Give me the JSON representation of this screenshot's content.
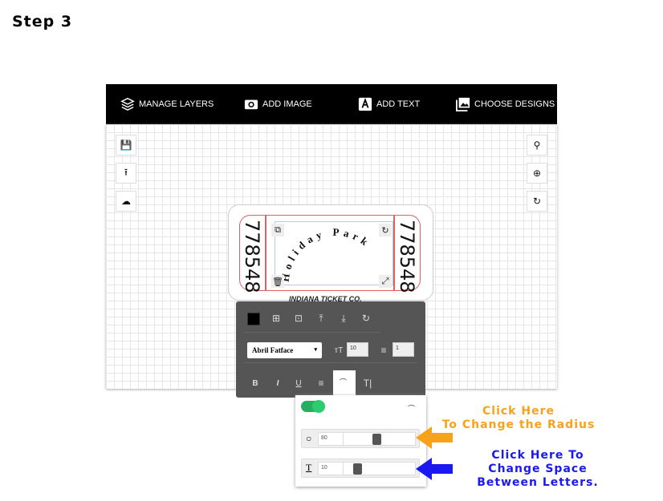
{
  "step_title": "Step 3",
  "toolbar": {
    "manage_layers": "MANAGE LAYERS",
    "add_image": "ADD IMAGE",
    "add_text": "ADD TEXT",
    "choose_designs": "CHOOSE DESIGNS"
  },
  "ticket": {
    "number_left": "778548",
    "number_right": "778548",
    "curved_text": "Holiday Park",
    "company": "INDIANA TICKET CO."
  },
  "editor": {
    "font": "Abril Fatface",
    "font_size": "10",
    "line_height": "1",
    "color": "#000000"
  },
  "curve_panel": {
    "toggle_on": true,
    "radius": "80",
    "radius_fraction": 0.45,
    "spacing": "10",
    "spacing_fraction": 0.15
  },
  "annotations": {
    "radius_line1": "Click Here",
    "radius_line2": "To Change the Radius",
    "spacing_line1": "Click Here To",
    "spacing_line2": "Change Space",
    "spacing_line3": "Between Letters.",
    "radius_color": "#f7a21b",
    "spacing_color": "#1a1aee"
  }
}
